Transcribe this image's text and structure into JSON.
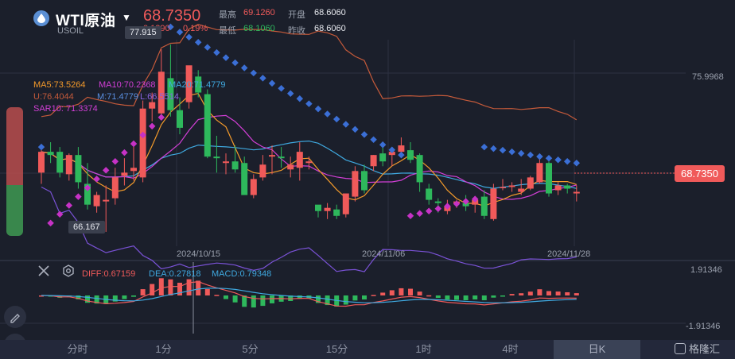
{
  "header": {
    "name": "WTI原油",
    "code": "USOIL",
    "price": "68.7350",
    "change": "0.1290",
    "change_pct": "0.19%",
    "high_label": "最高",
    "high": "69.1260",
    "low_label": "最低",
    "low": "68.1060",
    "open_label": "开盘",
    "open": "68.6060",
    "prev_label": "昨收",
    "prev": "68.6060"
  },
  "legend": {
    "ma5": "MA5:73.5264",
    "ma10": "MA10:70.2368",
    "ma20": "MA20:71.4779",
    "bb_u": "U:76.4044",
    "bb_m": "M:71.4779",
    "bb_l": "L:66.5514",
    "sar": "SAR10: 71.3374"
  },
  "chart": {
    "max_label": "77.915",
    "min_label": "66.167",
    "level_label": "75.9968",
    "current_tag": "68.7350",
    "dates": [
      "2024/10/15",
      "2024/11/06",
      "2024/11/28"
    ]
  },
  "macd": {
    "diff": "DIFF:0.67159",
    "dea": "DEA:0.27818",
    "macd": "MACD:0.79348",
    "top": "1.91346",
    "bottom": "-1.91346"
  },
  "tabs": [
    "分时",
    "1分",
    "5分",
    "15分",
    "1时",
    "4时",
    "日K"
  ],
  "active_tab": 6,
  "brand": "格隆汇",
  "colors": {
    "up": "#f05a5a",
    "down": "#2eb85c",
    "ma5": "#f39a2b",
    "ma10": "#d23fd6",
    "ma20": "#3fa9e0",
    "bb_u": "#c55a3a",
    "bb_l": "#7a52d6",
    "sar_up": "#3b6fd6",
    "sar_dn": "#c632c6",
    "background": "#1b1f2b"
  },
  "chart_data": {
    "type": "candlestick",
    "candles": [
      {
        "o": 69.9,
        "h": 71.6,
        "l": 69.2,
        "c": 71.2
      },
      {
        "o": 71.2,
        "h": 71.8,
        "l": 70.5,
        "c": 71.0
      },
      {
        "o": 71.2,
        "h": 71.5,
        "l": 69.6,
        "c": 69.9
      },
      {
        "o": 69.8,
        "h": 71.1,
        "l": 69.4,
        "c": 71.0
      },
      {
        "o": 71.0,
        "h": 71.5,
        "l": 68.9,
        "c": 69.3
      },
      {
        "o": 69.2,
        "h": 70.5,
        "l": 67.6,
        "c": 67.9
      },
      {
        "o": 67.8,
        "h": 68.7,
        "l": 67.4,
        "c": 68.5
      },
      {
        "o": 68.1,
        "h": 69.1,
        "l": 66.2,
        "c": 68.2
      },
      {
        "o": 68.3,
        "h": 70.2,
        "l": 67.9,
        "c": 69.6
      },
      {
        "o": 69.7,
        "h": 70.8,
        "l": 69.1,
        "c": 69.9
      },
      {
        "o": 70.0,
        "h": 71.9,
        "l": 69.4,
        "c": 70.2
      },
      {
        "o": 69.6,
        "h": 74.4,
        "l": 69.3,
        "c": 73.9
      },
      {
        "o": 73.9,
        "h": 74.9,
        "l": 73.1,
        "c": 74.3
      },
      {
        "o": 73.6,
        "h": 77.6,
        "l": 73.2,
        "c": 76.2
      },
      {
        "o": 75.8,
        "h": 77.9,
        "l": 73.4,
        "c": 73.8
      },
      {
        "o": 73.8,
        "h": 74.6,
        "l": 72.3,
        "c": 72.7
      },
      {
        "o": 74.3,
        "h": 76.5,
        "l": 73.9,
        "c": 76.6
      },
      {
        "o": 75.9,
        "h": 76.3,
        "l": 74.6,
        "c": 74.9
      },
      {
        "o": 74.8,
        "h": 75.1,
        "l": 70.8,
        "c": 70.9
      },
      {
        "o": 70.9,
        "h": 72.2,
        "l": 69.9,
        "c": 70.8
      },
      {
        "o": 70.5,
        "h": 71.1,
        "l": 69.8,
        "c": 70.6
      },
      {
        "o": 70.6,
        "h": 71.6,
        "l": 69.9,
        "c": 70.1
      },
      {
        "o": 70.5,
        "h": 70.9,
        "l": 68.6,
        "c": 68.5
      },
      {
        "o": 68.5,
        "h": 69.8,
        "l": 68.3,
        "c": 69.5
      },
      {
        "o": 69.6,
        "h": 71.0,
        "l": 69.4,
        "c": 70.4
      },
      {
        "o": 70.9,
        "h": 71.6,
        "l": 69.8,
        "c": 71.0
      },
      {
        "o": 70.9,
        "h": 71.5,
        "l": 70.2,
        "c": 70.8
      },
      {
        "o": 70.1,
        "h": 70.9,
        "l": 69.6,
        "c": 70.4
      },
      {
        "o": 70.2,
        "h": 71.8,
        "l": 69.4,
        "c": 71.2
      },
      {
        "o": 70.5,
        "h": 70.9,
        "l": 70.1,
        "c": 70.6
      },
      {
        "o": 67.9,
        "h": 67.7,
        "l": 67.1,
        "c": 67.5
      },
      {
        "o": 67.5,
        "h": 68.0,
        "l": 67.0,
        "c": 67.7
      },
      {
        "o": 67.6,
        "h": 67.9,
        "l": 67.0,
        "c": 67.2
      },
      {
        "o": 67.3,
        "h": 68.1,
        "l": 67.1,
        "c": 68.6
      },
      {
        "o": 68.4,
        "h": 70.3,
        "l": 68.1,
        "c": 70.0
      },
      {
        "o": 70.0,
        "h": 70.4,
        "l": 68.6,
        "c": 68.8
      },
      {
        "o": 70.3,
        "h": 71.0,
        "l": 70.0,
        "c": 71.0
      },
      {
        "o": 71.1,
        "h": 71.6,
        "l": 70.3,
        "c": 70.6
      },
      {
        "o": 71.0,
        "h": 71.4,
        "l": 70.3,
        "c": 71.2
      },
      {
        "o": 71.2,
        "h": 72.1,
        "l": 70.9,
        "c": 71.6
      },
      {
        "o": 71.3,
        "h": 71.8,
        "l": 70.5,
        "c": 70.7
      },
      {
        "o": 71.0,
        "h": 71.1,
        "l": 68.7,
        "c": 69.3
      },
      {
        "o": 68.9,
        "h": 69.2,
        "l": 67.9,
        "c": 68.2
      },
      {
        "o": 68.1,
        "h": 68.3,
        "l": 67.4,
        "c": 68.0
      },
      {
        "o": 67.5,
        "h": 68.2,
        "l": 67.3,
        "c": 67.8
      },
      {
        "o": 68.0,
        "h": 68.2,
        "l": 67.7,
        "c": 68.1
      },
      {
        "o": 68.0,
        "h": 68.5,
        "l": 67.5,
        "c": 67.8
      },
      {
        "o": 67.9,
        "h": 68.4,
        "l": 67.4,
        "c": 68.2
      },
      {
        "o": 68.4,
        "h": 68.8,
        "l": 67.0,
        "c": 67.2
      },
      {
        "o": 67.0,
        "h": 69.2,
        "l": 66.9,
        "c": 68.9
      },
      {
        "o": 69.0,
        "h": 69.5,
        "l": 68.8,
        "c": 69.0
      },
      {
        "o": 69.0,
        "h": 69.3,
        "l": 68.7,
        "c": 69.1
      },
      {
        "o": 68.7,
        "h": 69.5,
        "l": 68.5,
        "c": 68.9
      },
      {
        "o": 68.9,
        "h": 69.7,
        "l": 68.8,
        "c": 69.6
      },
      {
        "o": 69.3,
        "h": 70.8,
        "l": 69.2,
        "c": 70.5
      },
      {
        "o": 70.5,
        "h": 70.6,
        "l": 68.4,
        "c": 68.6
      },
      {
        "o": 68.8,
        "h": 69.3,
        "l": 68.5,
        "c": 69.1
      },
      {
        "o": 69.1,
        "h": 69.2,
        "l": 68.6,
        "c": 68.9
      },
      {
        "o": 68.6,
        "h": 69.1,
        "l": 68.1,
        "c": 68.7
      }
    ]
  }
}
